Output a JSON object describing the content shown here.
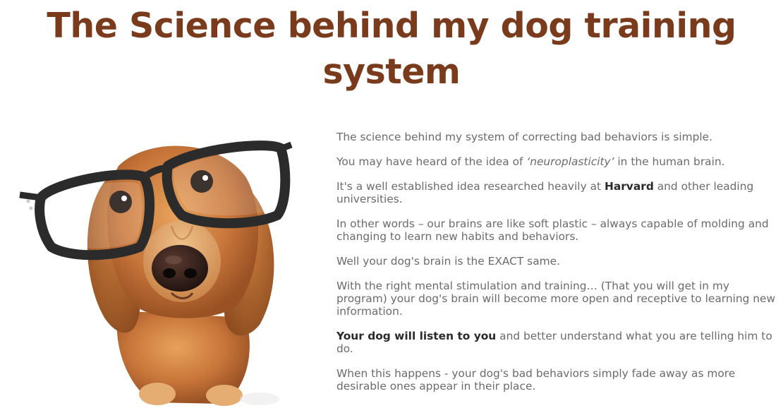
{
  "title": {
    "line1": "The Science behind my dog training",
    "line2": "system"
  },
  "image": {
    "alt": "Dachshund puppy wearing black glasses",
    "icon": "dog-with-glasses"
  },
  "paragraphs": {
    "p1": "The science behind my system of correcting bad behaviors is simple.",
    "p2_before": "You may have heard of the idea of ",
    "p2_em": "‘neuroplasticity’",
    "p2_after": " in the human brain.",
    "p3_before": "It's a well established idea researched heavily at ",
    "p3_bold": "Harvard",
    "p3_after": " and other leading universities.",
    "p4": "In other words – our brains are like soft plastic – always capable of molding and changing to learn new habits and behaviors.",
    "p5": "Well your dog's brain is the EXACT same.",
    "p6": "With the right mental stimulation and training… (That you will get in my program) your dog's brain will become more open and receptive to learning new information.",
    "p7_bold": "Your dog will listen to you",
    "p7_after": " and better understand what you are telling him to do.",
    "p8": "When this happens - your dog's bad behaviors simply fade away as more desirable ones appear in their place."
  },
  "colors": {
    "title": "#7a3b1c",
    "body_text": "#6b6b6b",
    "bold_text": "#2a2a2a"
  }
}
